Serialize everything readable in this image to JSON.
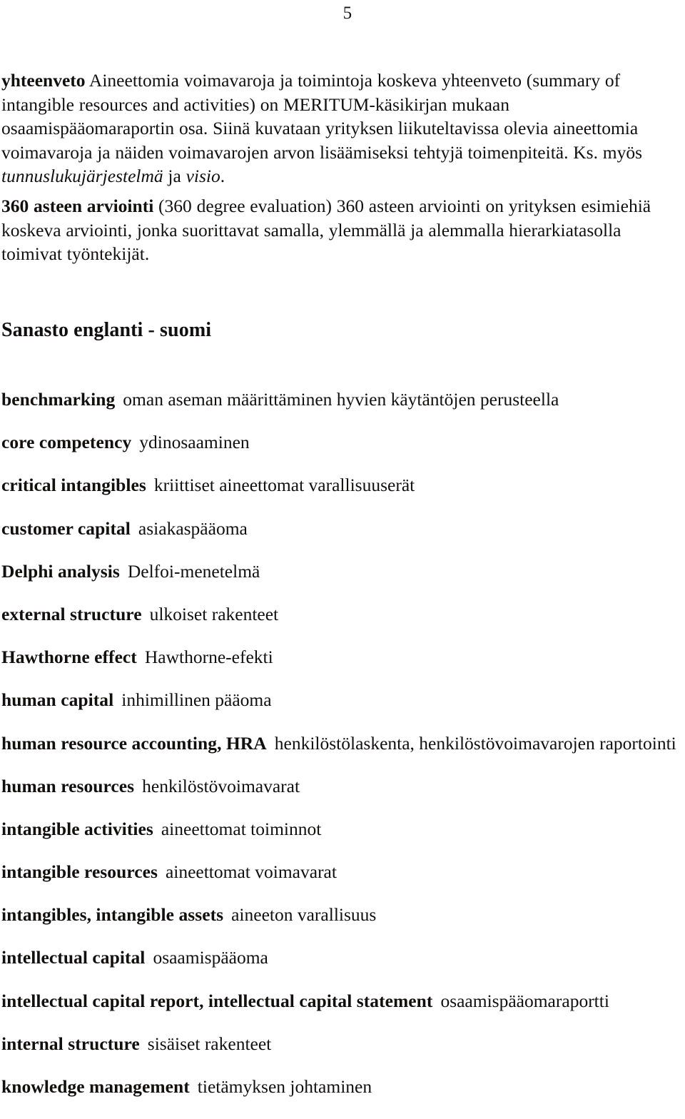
{
  "document": {
    "page_number": "5",
    "language": "fi"
  },
  "paragraphs": [
    {
      "id": "summary",
      "lead_term": "yhteenveto",
      "text_before_italic": " Aineettomia voimavaroja ja toimintoja koskeva yhteenveto (summary of intangible resources and activities) on MERITUM-käsikirjan mukaan osaamispääomaraportin osa. Siinä kuvataan yrityksen liikuteltavissa olevia aineettomia voimavaroja  ja näiden voimavarojen arvon lisäämiseksi tehtyjä toimenpiteitä. Ks. myös ",
      "italic_term_1": "tunnuslukujärjestelmä",
      "text_between": " ja ",
      "italic_term_2": "visio",
      "text_after": "."
    },
    {
      "id": "degree360",
      "lead_term": "360 asteen arviointi",
      "body": " (360 degree evaluation)  360 asteen arviointi on yrityksen esimiehiä koskeva arviointi, jonka suorittavat samalla, ylemmällä ja alemmalla hierarkiatasolla toimivat työntekijät."
    }
  ],
  "section": {
    "heading": "Sanasto englanti - suomi"
  },
  "glossary": [
    {
      "term": "benchmarking",
      "definition": "oman aseman määrittäminen hyvien käytäntöjen perusteella"
    },
    {
      "term": "core competency",
      "definition": "ydinosaaminen"
    },
    {
      "term": "critical intangibles",
      "definition": "kriittiset aineettomat varallisuuserät"
    },
    {
      "term": "customer capital",
      "definition": "asiakaspääoma"
    },
    {
      "term": "Delphi analysis",
      "definition": "Delfoi-menetelmä"
    },
    {
      "term": "external structure",
      "definition": "ulkoiset rakenteet"
    },
    {
      "term": "Hawthorne effect",
      "definition": "Hawthorne-efekti"
    },
    {
      "term": "human capital",
      "definition": "inhimillinen pääoma"
    },
    {
      "term": "human resource accounting, HRA",
      "definition": "henkilöstölaskenta, henkilöstövoimavarojen raportointi"
    },
    {
      "term": "human resources",
      "definition": "henkilöstövoimavarat"
    },
    {
      "term": "intangible activities",
      "definition": "aineettomat toiminnot"
    },
    {
      "term": "intangible resources",
      "definition": "aineettomat voimavarat"
    },
    {
      "term": "intangibles, intangible assets",
      "definition": "aineeton varallisuus"
    },
    {
      "term": "intellectual capital",
      "definition": "osaamispääoma"
    },
    {
      "term": "intellectual capital report, intellectual capital statement",
      "definition": "osaamispääomaraportti"
    },
    {
      "term": "internal structure",
      "definition": "sisäiset rakenteet"
    },
    {
      "term": "knowledge management",
      "definition": "tietämyksen johtaminen"
    }
  ],
  "colors": {
    "page_background": "#ffffff",
    "ink": "#120f0f"
  }
}
